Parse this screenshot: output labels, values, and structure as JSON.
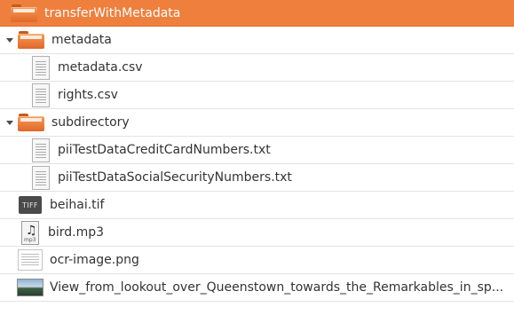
{
  "tree": {
    "root": {
      "label": "transferWithMetadata",
      "icon": "folder-icon"
    },
    "folders": [
      {
        "label": "metadata",
        "icon": "folder-icon",
        "expanded": true,
        "files": [
          {
            "label": "metadata.csv",
            "icon": "text-file-icon"
          },
          {
            "label": "rights.csv",
            "icon": "text-file-icon"
          }
        ]
      },
      {
        "label": "subdirectory",
        "icon": "folder-icon",
        "expanded": true,
        "files": [
          {
            "label": "piiTestDataCreditCardNumbers.txt",
            "icon": "text-file-icon"
          },
          {
            "label": "piiTestDataSocialSecurityNumbers.txt",
            "icon": "text-file-icon"
          }
        ]
      }
    ],
    "files": [
      {
        "label": "beihai.tif",
        "icon": "tiff-file-icon",
        "badge": "TIFF"
      },
      {
        "label": "bird.mp3",
        "icon": "audio-file-icon",
        "badge": "mp3"
      },
      {
        "label": "ocr-image.png",
        "icon": "image-file-icon"
      },
      {
        "label": "View_from_lookout_over_Queenstown_towards_the_Remarkables_in_sp...",
        "icon": "photo-thumbnail-icon"
      }
    ]
  },
  "colors": {
    "root_row": "#ef7f3d",
    "folder": "#e8753a",
    "row_divider": "#e3e3e3"
  }
}
